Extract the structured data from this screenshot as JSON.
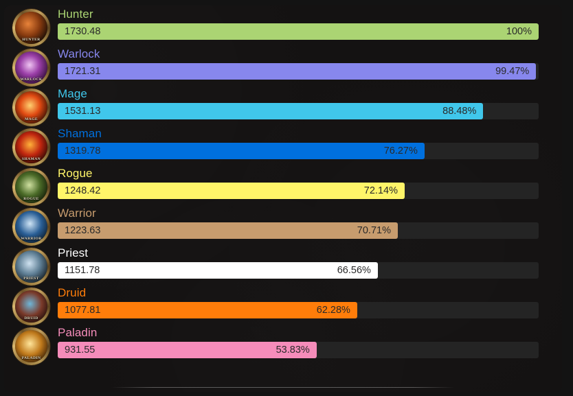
{
  "chart_data": {
    "type": "bar",
    "title": "",
    "xlabel": "",
    "ylabel": "",
    "orientation": "horizontal",
    "xlim": [
      0,
      1730.48
    ],
    "grid": false,
    "legend": "none",
    "max_value": 1730.48,
    "categories": [
      "Hunter",
      "Warlock",
      "Mage",
      "Shaman",
      "Rogue",
      "Warrior",
      "Priest",
      "Druid",
      "Paladin"
    ],
    "values": [
      1730.48,
      1721.31,
      1531.13,
      1319.78,
      1248.42,
      1223.63,
      1151.78,
      1077.81,
      931.55
    ],
    "percents": [
      100,
      99.47,
      88.48,
      76.27,
      72.14,
      70.71,
      66.56,
      62.28,
      53.83
    ],
    "value_labels": [
      "1730.48",
      "1721.31",
      "1531.13",
      "1319.78",
      "1248.42",
      "1223.63",
      "1151.78",
      "1077.81",
      "931.55"
    ],
    "percent_labels": [
      "100%",
      "99.47%",
      "88.48%",
      "76.27%",
      "72.14%",
      "70.71%",
      "66.56%",
      "62.28%",
      "53.83%"
    ],
    "colors": [
      "#ABD473",
      "#8787ED",
      "#40C7EB",
      "#0070DE",
      "#FFF569",
      "#C79C6E",
      "#FFFFFF",
      "#FF7D0A",
      "#F58CBA"
    ]
  },
  "rows": [
    {
      "name": "Hunter",
      "icon_name": "HUNTER",
      "value": "1730.48",
      "percent": "100%",
      "pct": 100,
      "color": "#ABD473"
    },
    {
      "name": "Warlock",
      "icon_name": "WARLOCK",
      "value": "1721.31",
      "percent": "99.47%",
      "pct": 99.47,
      "color": "#8787ED"
    },
    {
      "name": "Mage",
      "icon_name": "MAGE",
      "value": "1531.13",
      "percent": "88.48%",
      "pct": 88.48,
      "color": "#40C7EB"
    },
    {
      "name": "Shaman",
      "icon_name": "SHAMAN",
      "value": "1319.78",
      "percent": "76.27%",
      "pct": 76.27,
      "color": "#0070DE"
    },
    {
      "name": "Rogue",
      "icon_name": "ROGUE",
      "value": "1248.42",
      "percent": "72.14%",
      "pct": 72.14,
      "color": "#FFF569"
    },
    {
      "name": "Warrior",
      "icon_name": "WARRIOR",
      "value": "1223.63",
      "percent": "70.71%",
      "pct": 70.71,
      "color": "#C79C6E"
    },
    {
      "name": "Priest",
      "icon_name": "PRIEST",
      "value": "1151.78",
      "percent": "66.56%",
      "pct": 66.56,
      "color": "#FFFFFF"
    },
    {
      "name": "Druid",
      "icon_name": "DRUID",
      "value": "1077.81",
      "percent": "62.28%",
      "pct": 62.28,
      "color": "#FF7D0A"
    },
    {
      "name": "Paladin",
      "icon_name": "PALADIN",
      "value": "931.55",
      "percent": "53.83%",
      "pct": 53.83,
      "color": "#F58CBA"
    }
  ],
  "icon_art": {
    "Hunter": "radial-gradient(circle at 40% 38%, #e8833a 0%, #8a3c10 42%, #160c06 80%)",
    "Warlock": "radial-gradient(circle at 45% 42%, #efc4f2 0%, #9b3fa8 38%, #2a0a31 82%)",
    "Mage": "radial-gradient(circle at 46% 44%, #ffd070 0%, #e04a12 40%, #230802 84%)",
    "Shaman": "radial-gradient(circle at 46% 42%, #ffb13a 0%, #c0260f 42%, #1b0503 84%)",
    "Rogue": "radial-gradient(circle at 44% 44%, #cfe0a0 0%, #4b6b28 42%, #0e1405 84%)",
    "Warrior": "radial-gradient(circle at 46% 40%, #cfe4f5 0%, #2a5f96 44%, #07131f 86%)",
    "Priest": "radial-gradient(circle at 44% 40%, #cfe2f0 0%, #5f7f95 42%, #0c1318 84%)",
    "Druid": "radial-gradient(circle at 46% 42%, #6fb6d8 0%, #7a3a2a 46%, #140806 86%)",
    "Paladin": "radial-gradient(circle at 46% 42%, #ffe59a 0%, #c07a1c 44%, #2a1403 86%)"
  },
  "divider": {
    "label": "bottom-divider"
  }
}
